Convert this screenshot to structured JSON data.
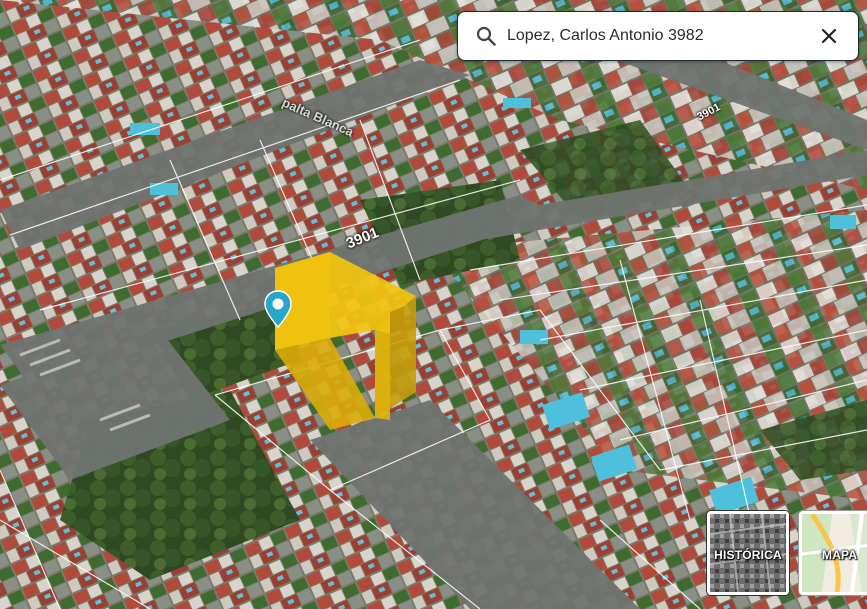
{
  "search": {
    "value": "Lopez, Carlos Antonio 3982",
    "icon": "search-icon",
    "clear_icon": "close-icon"
  },
  "layers": [
    {
      "label": "HISTÓRICA",
      "active": true
    },
    {
      "label": "MAPA",
      "active": false
    }
  ],
  "map": {
    "street_numbers": [
      "3901",
      "3901"
    ],
    "street_name": "palta Blanca",
    "highlight_color": "#f2c40f",
    "pin_color": "#27a7c9"
  }
}
